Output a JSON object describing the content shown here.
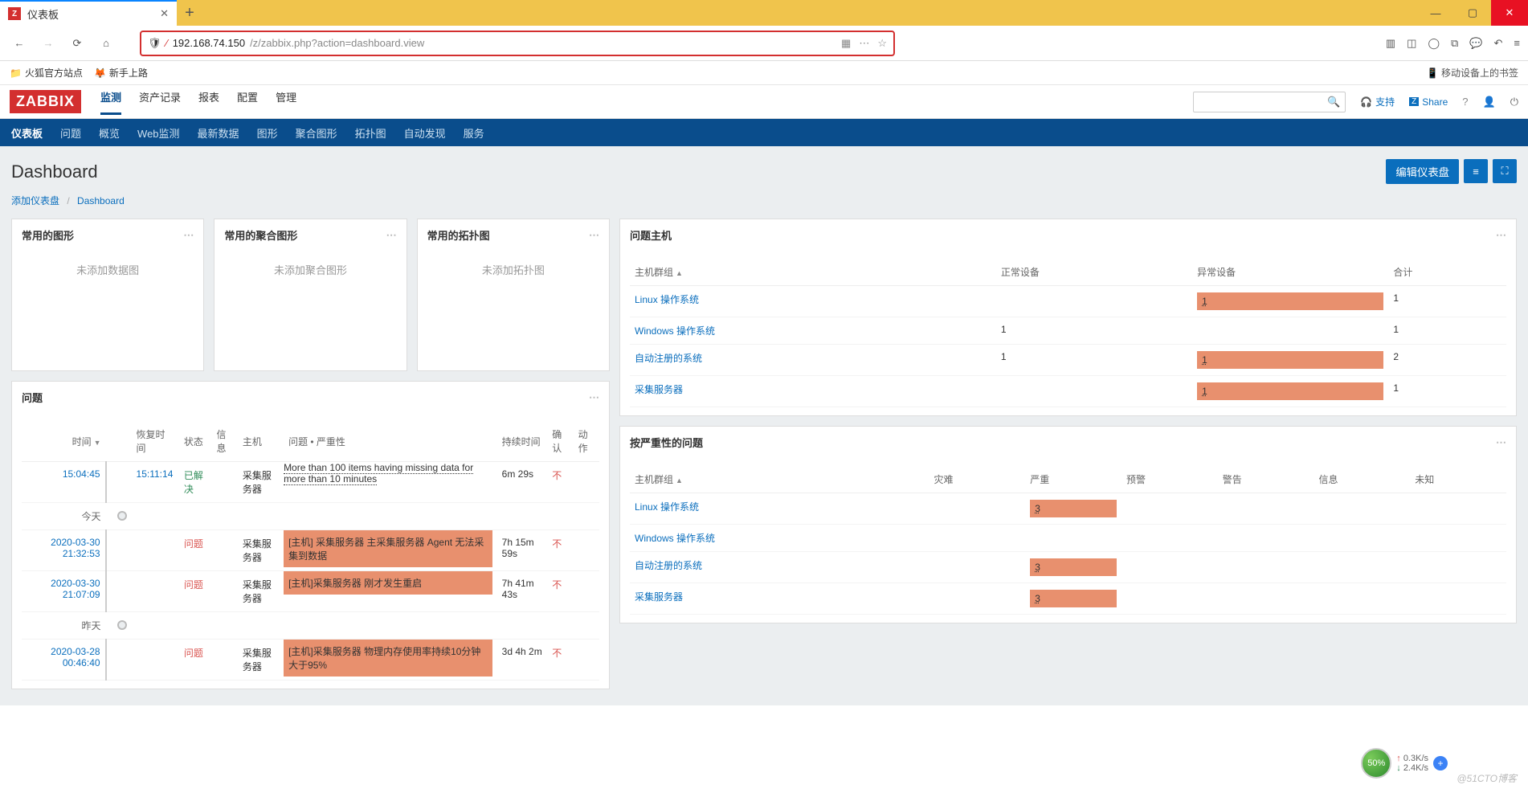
{
  "browser": {
    "tab_title": "仪表板",
    "url_host": "192.168.74.150",
    "url_path": "/z/zabbix.php?action=dashboard.view",
    "bookmarks": {
      "b1": "火狐官方站点",
      "b2": "新手上路",
      "mobile": "移动设备上的书签"
    }
  },
  "logo": "ZABBIX",
  "topmenu": {
    "m1": "监测",
    "m2": "资产记录",
    "m3": "报表",
    "m4": "配置",
    "m5": "管理"
  },
  "header_right": {
    "support": "支持",
    "share": "Share"
  },
  "submenu": {
    "s1": "仪表板",
    "s2": "问题",
    "s3": "概览",
    "s4": "Web监测",
    "s5": "最新数据",
    "s6": "图形",
    "s7": "聚合图形",
    "s8": "拓扑图",
    "s9": "自动发现",
    "s10": "服务"
  },
  "page": {
    "title": "Dashboard",
    "edit": "编辑仪表盘"
  },
  "breadcrumb": {
    "a": "添加仪表盘",
    "b": "Dashboard"
  },
  "widgets": {
    "graphs": {
      "title": "常用的图形",
      "empty": "未添加数据图"
    },
    "screens": {
      "title": "常用的聚合图形",
      "empty": "未添加聚合图形"
    },
    "maps": {
      "title": "常用的拓扑图",
      "empty": "未添加拓扑图"
    },
    "host_problems": {
      "title": "问题主机",
      "cols": {
        "group": "主机群组",
        "ok": "正常设备",
        "bad": "异常设备",
        "total": "合计"
      },
      "rows": [
        {
          "group": "Linux 操作系统",
          "ok": "",
          "bad": "1",
          "total": "1"
        },
        {
          "group": "Windows 操作系统",
          "ok": "1",
          "bad": "",
          "total": "1"
        },
        {
          "group": "自动注册的系统",
          "ok": "1",
          "bad": "1",
          "total": "2"
        },
        {
          "group": "采集服务器",
          "ok": "",
          "bad": "1",
          "total": "1"
        }
      ]
    },
    "problems": {
      "title": "问题",
      "cols": {
        "time": "时间",
        "recovery": "恢复时间",
        "status": "状态",
        "info": "信息",
        "host": "主机",
        "issue": "问题 • 严重性",
        "duration": "持续时间",
        "ack": "确认",
        "actions": "动作"
      },
      "today": "今天",
      "yesterday": "昨天",
      "rows": [
        {
          "time": "15:04:45",
          "recovery": "15:11:14",
          "status": "已解决",
          "status_class": "resolved",
          "host": "采集服务器",
          "issue": "More than 100 items having missing data for more than 10 minutes",
          "issue_class": "underdot",
          "duration": "6m 29s",
          "ack": "不"
        },
        {
          "sep": "today"
        },
        {
          "time": "2020-03-30 21:32:53",
          "recovery": "",
          "status": "问题",
          "status_class": "problem",
          "host": "采集服务器",
          "issue": "[主机] 采集服务器 主采集服务器 Agent 无法采集到数据",
          "issue_class": "cell-orange",
          "duration": "7h 15m 59s",
          "ack": "不"
        },
        {
          "time": "2020-03-30 21:07:09",
          "recovery": "",
          "status": "问题",
          "status_class": "problem",
          "host": "采集服务器",
          "issue": "[主机]采集服务器 刚才发生重启",
          "issue_class": "cell-orange",
          "duration": "7h 41m 43s",
          "ack": "不"
        },
        {
          "sep": "yesterday"
        },
        {
          "time": "2020-03-28 00:46:40",
          "recovery": "",
          "status": "问题",
          "status_class": "problem",
          "host": "采集服务器",
          "issue": "[主机]采集服务器 物理内存使用率持续10分钟大于95%",
          "issue_class": "cell-orange",
          "duration": "3d 4h 2m",
          "ack": "不"
        }
      ]
    },
    "severity": {
      "title": "按严重性的问题",
      "cols": {
        "group": "主机群组",
        "disaster": "灾难",
        "high": "严重",
        "avg": "预警",
        "warn": "警告",
        "info": "信息",
        "unknown": "未知"
      },
      "rows": [
        {
          "group": "Linux 操作系统",
          "high": "3"
        },
        {
          "group": "Windows 操作系统",
          "high": ""
        },
        {
          "group": "自动注册的系统",
          "high": "3"
        },
        {
          "group": "采集服务器",
          "high": "3"
        }
      ]
    }
  },
  "netmeter": {
    "pct": "50%",
    "up": "0.3K/s",
    "down": "2.4K/s"
  },
  "watermark": "@51CTO博客"
}
